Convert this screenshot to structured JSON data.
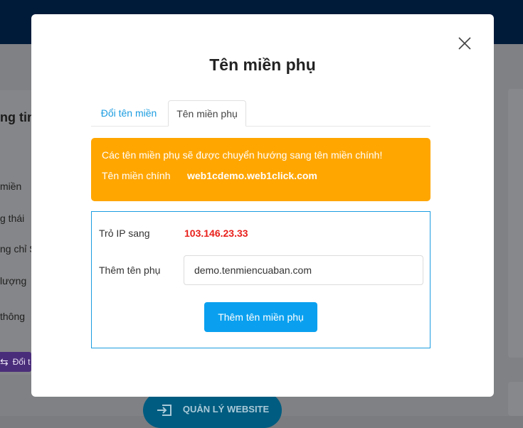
{
  "background": {
    "heading": "ng tin",
    "labels": [
      "miền",
      "g thái",
      "ng chỉ SS",
      "lượng",
      "thông"
    ],
    "left_button_label": "Đổi t",
    "manage_button_label": "QUẢN LÝ WEBSITE"
  },
  "modal": {
    "title": "Tên miền phụ",
    "tabs": [
      {
        "label": "Đổi tên miền",
        "active": false
      },
      {
        "label": "Tên miền phụ",
        "active": true
      }
    ],
    "notice": {
      "message": "Các tên miền phụ sẽ được chuyển hướng sang tên miền chính!",
      "main_domain_label": "Tên miền chính",
      "main_domain_value": "web1cdemo.web1click.com"
    },
    "form": {
      "ip_label": "Trỏ IP sang",
      "ip_value": "103.146.23.33",
      "subdomain_label": "Thêm tên phụ",
      "subdomain_placeholder": "demo.tenmiencuaban.com",
      "submit_label": "Thêm tên miền phụ"
    }
  },
  "colors": {
    "accent": "#1b9ce0",
    "notice": "#ffa600",
    "ip": "#e8201b",
    "button": "#0aa0ef"
  }
}
